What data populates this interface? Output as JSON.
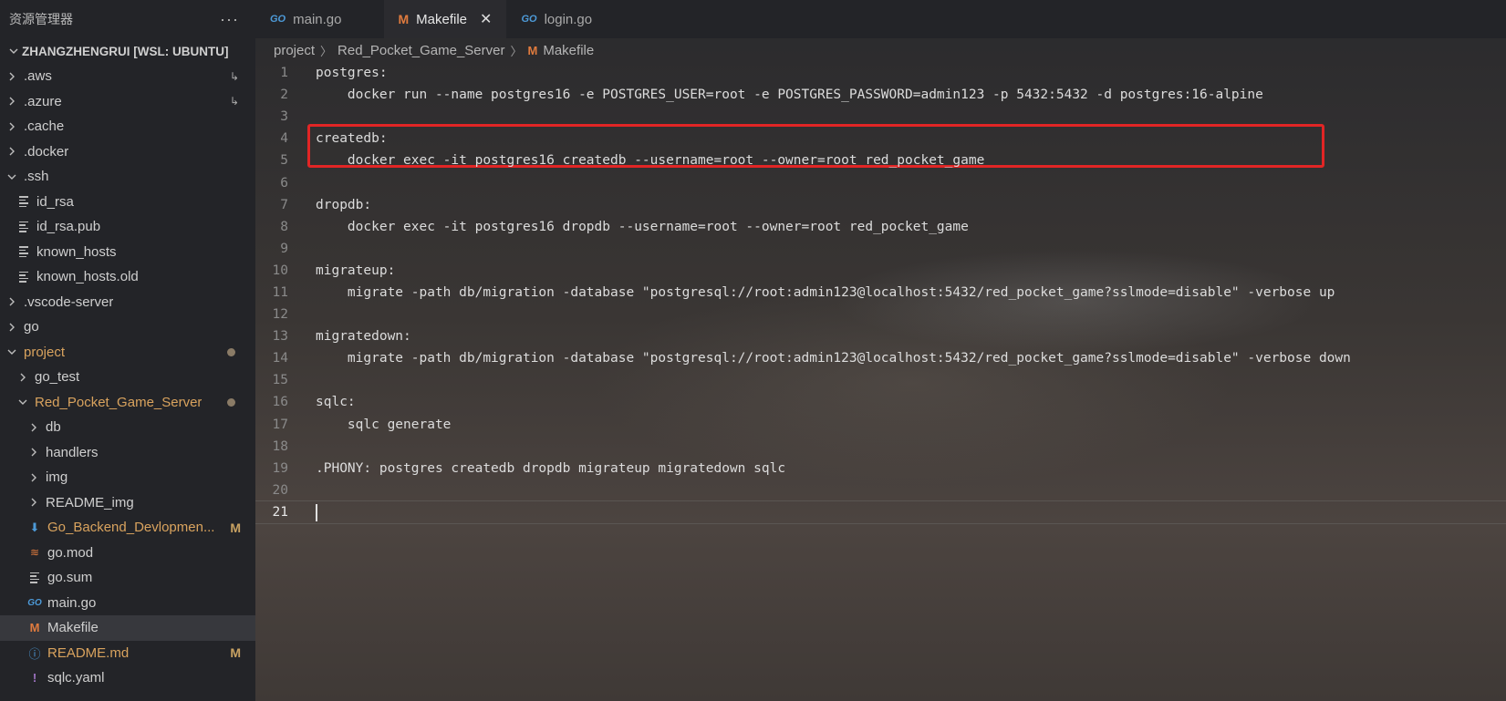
{
  "sidebar": {
    "title": "资源管理器",
    "more_icon": "ellipsis-icon",
    "root": "ZHANGZHENGRUI [WSL: UBUNTU]",
    "items": [
      {
        "label": ".aws",
        "type": "folder",
        "expanded": false,
        "depth": 0,
        "marker": "link"
      },
      {
        "label": ".azure",
        "type": "folder",
        "expanded": false,
        "depth": 0,
        "marker": "link"
      },
      {
        "label": ".cache",
        "type": "folder",
        "expanded": false,
        "depth": 0
      },
      {
        "label": ".docker",
        "type": "folder",
        "expanded": false,
        "depth": 0
      },
      {
        "label": ".ssh",
        "type": "folder",
        "expanded": true,
        "depth": 0
      },
      {
        "label": "id_rsa",
        "type": "file",
        "depth": 1
      },
      {
        "label": "id_rsa.pub",
        "type": "file",
        "depth": 1
      },
      {
        "label": "known_hosts",
        "type": "file",
        "depth": 1
      },
      {
        "label": "known_hosts.old",
        "type": "file",
        "depth": 1
      },
      {
        "label": ".vscode-server",
        "type": "folder",
        "expanded": false,
        "depth": 0
      },
      {
        "label": "go",
        "type": "folder",
        "expanded": false,
        "depth": 0
      },
      {
        "label": "project",
        "type": "folder",
        "expanded": true,
        "depth": 0,
        "modified": true
      },
      {
        "label": "go_test",
        "type": "folder",
        "expanded": false,
        "depth": 1
      },
      {
        "label": "Red_Pocket_Game_Server",
        "type": "folder",
        "expanded": true,
        "depth": 1,
        "modified": true
      },
      {
        "label": "db",
        "type": "folder",
        "expanded": false,
        "depth": 2
      },
      {
        "label": "handlers",
        "type": "folder",
        "expanded": false,
        "depth": 2
      },
      {
        "label": "img",
        "type": "folder",
        "expanded": false,
        "depth": 2
      },
      {
        "label": "README_img",
        "type": "folder",
        "expanded": false,
        "depth": 2
      },
      {
        "label": "Go_Backend_Devlopmen...",
        "type": "file",
        "depth": 2,
        "badge": "M"
      },
      {
        "label": "go.mod",
        "type": "file",
        "depth": 2
      },
      {
        "label": "go.sum",
        "type": "file",
        "depth": 2
      },
      {
        "label": "main.go",
        "type": "file",
        "depth": 2
      },
      {
        "label": "Makefile",
        "type": "file",
        "depth": 2,
        "active": true
      },
      {
        "label": "README.md",
        "type": "file",
        "depth": 2,
        "badge": "M"
      },
      {
        "label": "sqlc.yaml",
        "type": "file",
        "depth": 2
      }
    ]
  },
  "tabs": [
    {
      "label": "main.go",
      "icon": "go-file-icon",
      "active": false
    },
    {
      "label": "Makefile",
      "icon": "makefile-icon",
      "active": true
    },
    {
      "label": "login.go",
      "icon": "go-file-icon",
      "active": false
    }
  ],
  "tab_icons": {
    "go": "GO",
    "makefile": "M",
    "close": "✕"
  },
  "breadcrumb": [
    "project",
    "Red_Pocket_Game_Server",
    "Makefile"
  ],
  "editor": {
    "lines": [
      {
        "n": "1",
        "text": "postgres:"
      },
      {
        "n": "2",
        "text": "    docker run --name postgres16 -e POSTGRES_USER=root -e POSTGRES_PASSWORD=admin123 -p 5432:5432 -d postgres:16-alpine"
      },
      {
        "n": "3",
        "text": ""
      },
      {
        "n": "4",
        "text": "createdb:"
      },
      {
        "n": "5",
        "text": "    docker exec -it postgres16 createdb --username=root --owner=root red_pocket_game"
      },
      {
        "n": "6",
        "text": ""
      },
      {
        "n": "7",
        "text": "dropdb:"
      },
      {
        "n": "8",
        "text": "    docker exec -it postgres16 dropdb --username=root --owner=root red_pocket_game"
      },
      {
        "n": "9",
        "text": ""
      },
      {
        "n": "10",
        "text": "migrateup:"
      },
      {
        "n": "11",
        "text": "    migrate -path db/migration -database \"postgresql://root:admin123@localhost:5432/red_pocket_game?sslmode=disable\" -verbose up"
      },
      {
        "n": "12",
        "text": ""
      },
      {
        "n": "13",
        "text": "migratedown:"
      },
      {
        "n": "14",
        "text": "    migrate -path db/migration -database \"postgresql://root:admin123@localhost:5432/red_pocket_game?sslmode=disable\" -verbose down"
      },
      {
        "n": "15",
        "text": ""
      },
      {
        "n": "16",
        "text": "sqlc:"
      },
      {
        "n": "17",
        "text": "    sqlc generate"
      },
      {
        "n": "18",
        "text": ""
      },
      {
        "n": "19",
        "text": ".PHONY: postgres createdb dropdb migrateup migratedown sqlc"
      },
      {
        "n": "20",
        "text": ""
      },
      {
        "n": "21",
        "text": ""
      }
    ],
    "current_line": "21",
    "highlight_color": "#e12525"
  }
}
